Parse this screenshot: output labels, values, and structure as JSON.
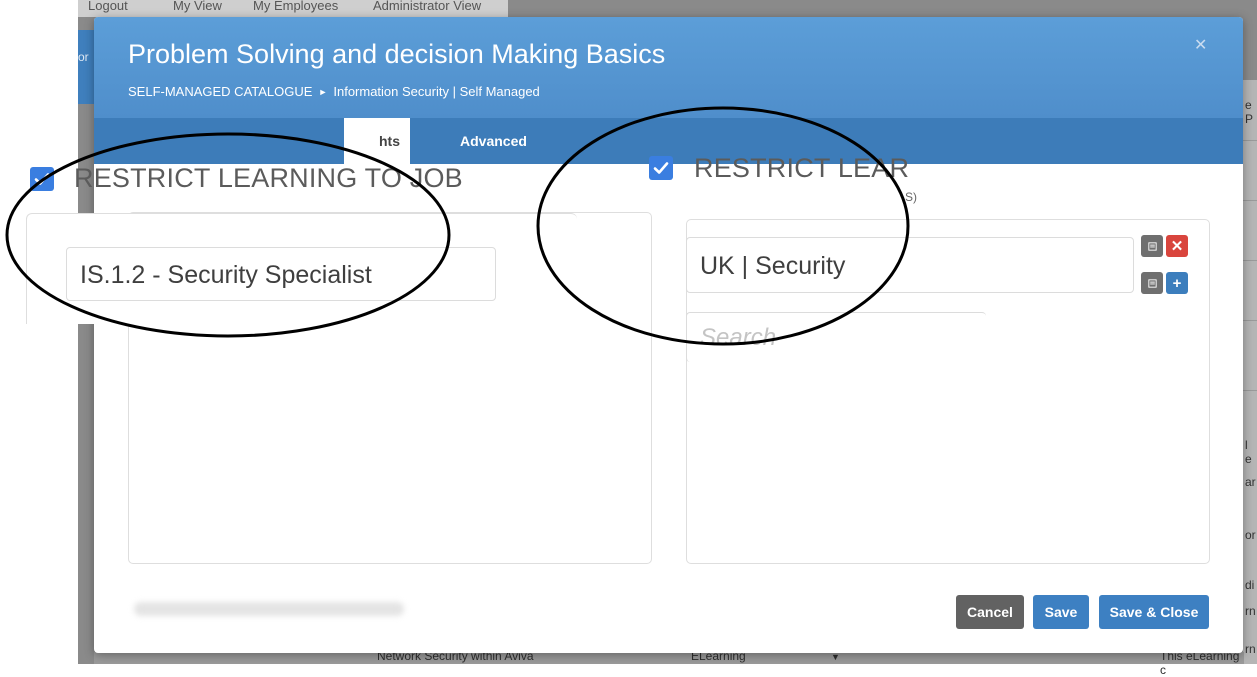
{
  "background": {
    "top_nav": [
      "Logout",
      "My View",
      "My Employees",
      "Administrator View"
    ],
    "side_text": "or",
    "right_edge_text": [
      "e P",
      "l e",
      "ar",
      "or",
      "di",
      "rn",
      "rn"
    ],
    "bottom_row": [
      "Network Security within Aviva",
      "ELearning",
      "This eLearning c"
    ]
  },
  "modal": {
    "title": "Problem Solving and decision Making Basics",
    "breadcrumb": {
      "root": "SELF-MANAGED CATALOGUE",
      "separator": "►",
      "current": "Information Security | Self Managed"
    },
    "close_icon": "close-icon",
    "tabs": [
      {
        "label": "hts",
        "active": true
      },
      {
        "label": "Advanced",
        "active": false
      }
    ]
  },
  "job_restriction": {
    "checked": true,
    "label": "RESTRICT LEARNING TO JOB",
    "selected_value": "IS.1.2 - Security Specialist"
  },
  "group_restriction": {
    "checked": true,
    "label": "RESTRICT LEAR",
    "sub_label_fragment": "S)",
    "selected_value": "UK | Security",
    "search_placeholder": "Search",
    "icons": [
      "list-icon",
      "close-icon",
      "list-icon",
      "plus-icon"
    ]
  },
  "footer": {
    "cancel_label": "Cancel",
    "save_label": "Save",
    "save_close_label": "Save & Close"
  },
  "colors": {
    "header_blue": "#5b9bd5",
    "tab_bar_blue": "#3d7cb9",
    "primary_button": "#3d80c2",
    "cancel_button": "#626262",
    "delete_red": "#d9453d",
    "checkbox_blue": "#3a7ee0"
  }
}
